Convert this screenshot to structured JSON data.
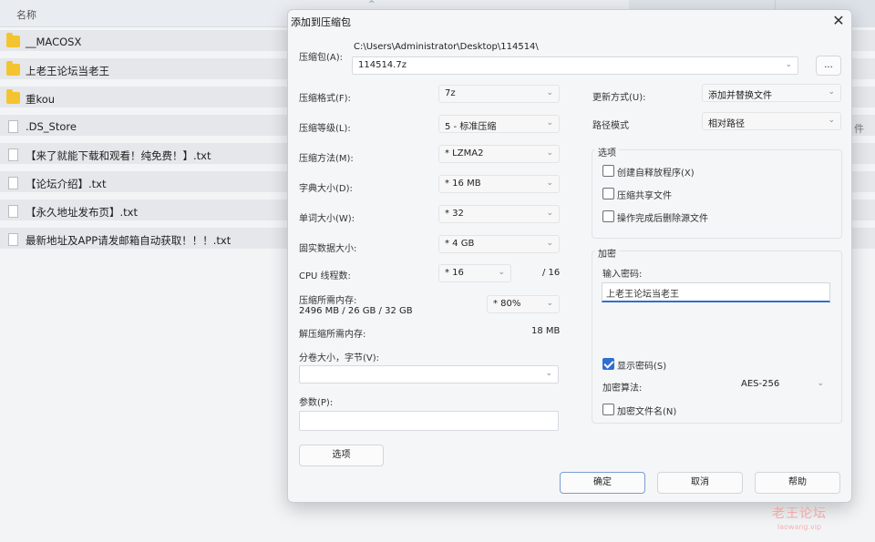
{
  "explorer": {
    "header_name": "名称",
    "sort_glyph": "^",
    "right_edge_char": "件",
    "files": [
      {
        "icon": "folder-icon",
        "name": "__MACOSX"
      },
      {
        "icon": "folder-icon",
        "name": "上老王论坛当老王"
      },
      {
        "icon": "folder-icon",
        "name": "重kou"
      },
      {
        "icon": "file-icon",
        "name": ".DS_Store"
      },
      {
        "icon": "file-icon",
        "name": "【来了就能下载和观看！纯免费！】.txt"
      },
      {
        "icon": "file-icon",
        "name": "【论坛介绍】.txt"
      },
      {
        "icon": "file-icon",
        "name": "【永久地址发布页】.txt"
      },
      {
        "icon": "file-icon",
        "name": "最新地址及APP请发邮箱自动获取！！！.txt"
      }
    ]
  },
  "dialog": {
    "title": "添加到压缩包",
    "close_glyph": "✕",
    "archive_label": "压缩包(A):",
    "archive_path": "C:\\Users\\Administrator\\Desktop\\114514\\",
    "archive_name": "114514.7z",
    "browse_label": "...",
    "format_label": "压缩格式(F):",
    "format_value": "7z",
    "level_label": "压缩等级(L):",
    "level_value": "5 - 标准压缩",
    "method_label": "压缩方法(M):",
    "method_value": "* LZMA2",
    "dict_label": "字典大小(D):",
    "dict_value": "* 16 MB",
    "word_label": "单词大小(W):",
    "word_value": "* 32",
    "solid_label": "固实数据大小:",
    "solid_value": "* 4 GB",
    "cpu_label": "CPU 线程数:",
    "cpu_value": "* 16",
    "cpu_total": "/ 16",
    "mem_label": "压缩所需内存:",
    "mem_value": "2496 MB / 26 GB / 32 GB",
    "mem_percent": "* 80%",
    "decomp_label": "解压缩所需内存:",
    "decomp_value": "18 MB",
    "split_label": "分卷大小，字节(V):",
    "split_value": "",
    "params_label": "参数(P):",
    "params_value": "",
    "options_button": "选项",
    "update_label": "更新方式(U):",
    "update_value": "添加并替换文件",
    "path_label": "路径模式",
    "path_value": "相对路径",
    "options_group": "选项",
    "opt_sfx": "创建自释放程序(X)",
    "opt_shared": "压缩共享文件",
    "opt_delete": "操作完成后删除源文件",
    "encrypt_group": "加密",
    "pwd_label": "输入密码:",
    "pwd_value": "上老王论坛当老王",
    "show_pwd": "显示密码(S)",
    "enc_method_label": "加密算法:",
    "enc_method_value": "AES-256",
    "enc_names": "加密文件名(N)",
    "ok": "确定",
    "cancel": "取消",
    "help": "帮助"
  },
  "watermark": {
    "line1": "老王论坛",
    "line2": "laowang.vip"
  },
  "colors": {
    "accent": "#2f6fd0",
    "folder": "#f4c430"
  }
}
